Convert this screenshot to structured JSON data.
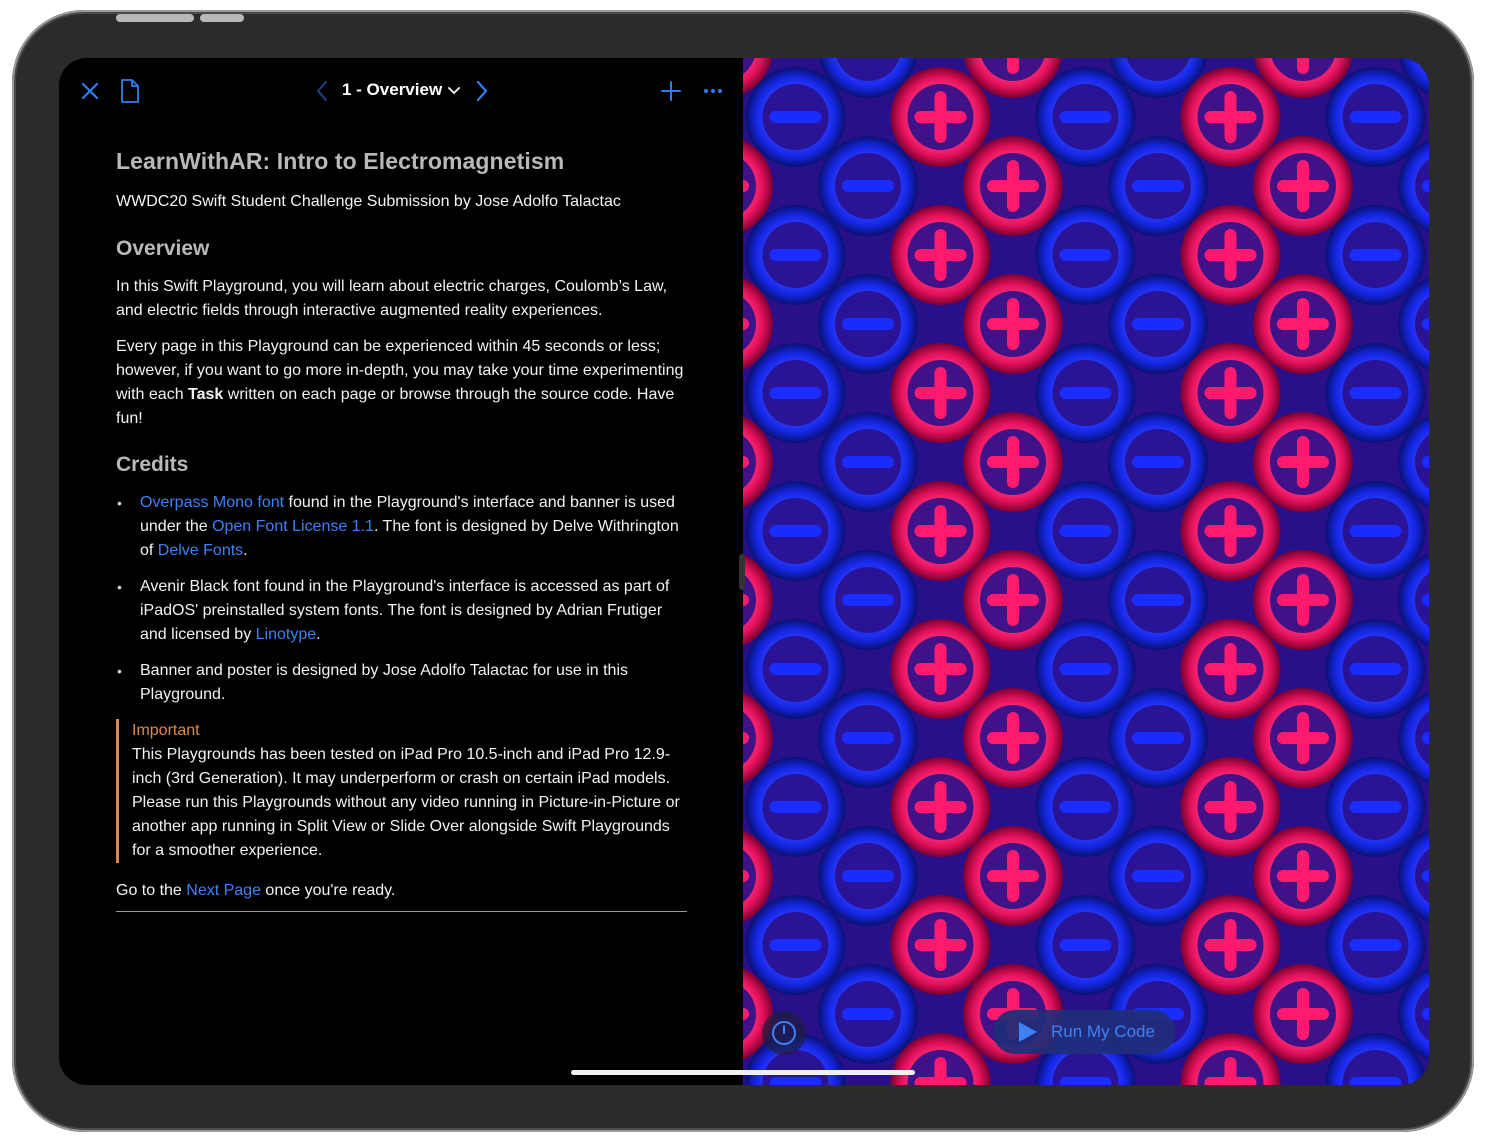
{
  "toolbar": {
    "page_title": "1 - Overview"
  },
  "document": {
    "title": "LearnWithAR: Intro to Electromagnetism",
    "subtitle": "WWDC20 Swift Student Challenge Submission by Jose Adolfo Talactac",
    "overview_heading": "Overview",
    "overview_p1": "In this Swift Playground, you will learn about electric charges, Coulomb’s Law, and electric fields through interactive augmented reality experiences.",
    "overview_p2_a": "Every page in this Playground can be experienced within 45 seconds or less; however, if you want to go more in-depth, you may take your time experimenting with each ",
    "overview_p2_bold": "Task",
    "overview_p2_b": " written on each page or browse through the source code. Have fun!",
    "credits_heading": "Credits",
    "credit1_link1": "Overpass Mono font",
    "credit1_t1": " found in the Playground's interface and banner is used under the ",
    "credit1_link2": "Open Font License 1.1",
    "credit1_t2": ". The font is designed by Delve Withrington of ",
    "credit1_link3": "Delve Fonts",
    "credit1_t3": ".",
    "credit2_t1": "Avenir Black font found in the Playground's interface is accessed as part of iPadOS' preinstalled system fonts. The font is designed by Adrian Frutiger and licensed by ",
    "credit2_link": "Linotype",
    "credit2_t2": ".",
    "credit3": "Banner and poster is designed by Jose Adolfo Talactac for use in this Playground.",
    "important_label": "Important",
    "important_text": "This Playgrounds has been tested on iPad Pro 10.5-inch and iPad Pro 12.9-inch (3rd Generation). It may underperform or crash on certain iPad models. Please run this Playgrounds without any video running in Picture-in-Picture or another app running in Split View or Slide Over alongside Swift Playgrounds for a smoother experience.",
    "footer_t1": "Go to the ",
    "footer_link": "Next Page",
    "footer_t2": " once you're ready."
  },
  "live_view": {
    "run_button_label": "Run My Code",
    "charge_colors": {
      "positive": "#ff1a6e",
      "negative": "#1a2cff",
      "background": "#2a0f8a"
    }
  },
  "icons": {
    "close": "close-icon",
    "document": "document-icon",
    "prev": "chevron-left-icon",
    "next": "chevron-right-icon",
    "add": "plus-icon",
    "more": "ellipsis-icon",
    "speed": "speedometer-icon",
    "run": "play-icon"
  }
}
